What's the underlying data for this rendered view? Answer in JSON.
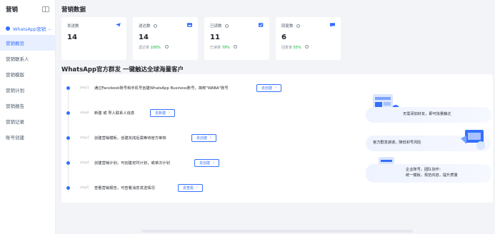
{
  "sidebar": {
    "title": "营销",
    "group_label": "WhatsApp营销",
    "items": [
      {
        "label": "营销概览",
        "active": true
      },
      {
        "label": "营销联系人",
        "active": false
      },
      {
        "label": "营销模版",
        "active": false
      },
      {
        "label": "营销计划",
        "active": false
      },
      {
        "label": "营销报告",
        "active": false
      },
      {
        "label": "营销记录",
        "active": false
      },
      {
        "label": "账号创建",
        "active": false
      }
    ]
  },
  "header": {
    "title": "营销数据"
  },
  "stats": [
    {
      "label": "发送数",
      "value": "14",
      "sub": "",
      "sub_value": "",
      "icon": "send-icon"
    },
    {
      "label": "送达数",
      "value": "14",
      "sub": "送达率",
      "sub_value": "100%",
      "icon": "inbox-icon"
    },
    {
      "label": "已读数",
      "value": "11",
      "sub": "已读率",
      "sub_value": "79%",
      "icon": "check-box-icon"
    },
    {
      "label": "回复数",
      "value": "6",
      "sub": "回复率",
      "sub_value": "55%",
      "icon": "chat-icon"
    }
  ],
  "section": {
    "title": "WhatsApp官方群发 一键触达全球海量客户"
  },
  "steps": [
    {
      "no": "step1",
      "text": "通过Facebook账号和手机号创建WhatsApp Business账号，简称\"WABA\"账号",
      "button": "去创建"
    },
    {
      "no": "step2",
      "text": "新建 或 导入联系人信息",
      "button": "去新建"
    },
    {
      "no": "step3",
      "text": "创建营销模板，创建完成后需等待官方审核",
      "button": "去创建"
    },
    {
      "no": "step4",
      "text": "创建营销计划，可创建定时计划，或单次计划",
      "button": "去创建"
    },
    {
      "no": "step5",
      "text": "查看营销报告，可查看消息发送情况",
      "button": "去查看"
    }
  ],
  "promos": [
    {
      "line1": "无需添加好友，即可批量触达",
      "line2": ""
    },
    {
      "line1": "官方群发通道，降低封号风险",
      "line2": ""
    },
    {
      "line1": "企业账号，团队协作：",
      "line2": "统一模板，规范内容，提升质量"
    }
  ],
  "colors": {
    "accent": "#3370ff",
    "success": "#00b42a",
    "background": "#f3f4f7"
  }
}
